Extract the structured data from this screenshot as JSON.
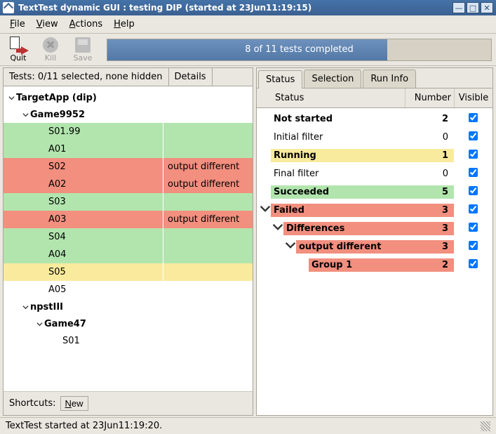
{
  "title": "TextTest dynamic GUI : testing DIP (started at 23Jun11:19:15)",
  "menus": {
    "file": "File",
    "view": "View",
    "actions": "Actions",
    "help": "Help"
  },
  "toolbar": {
    "quit": "Quit",
    "kill": "Kill",
    "save": "Save"
  },
  "progress": {
    "text": "8 of 11 tests completed",
    "percent": 73
  },
  "left": {
    "selection": "Tests: 0/11 selected, none hidden",
    "details": "Details",
    "root": "TargetApp (dip)",
    "suite1": "Game9952",
    "tests1": [
      {
        "name": "S01.99",
        "detail": "",
        "color": "green"
      },
      {
        "name": "A01",
        "detail": "",
        "color": "green"
      },
      {
        "name": "S02",
        "detail": "output different",
        "color": "red"
      },
      {
        "name": "A02",
        "detail": "output different",
        "color": "red"
      },
      {
        "name": "S03",
        "detail": "",
        "color": "green"
      },
      {
        "name": "A03",
        "detail": "output different",
        "color": "red"
      },
      {
        "name": "S04",
        "detail": "",
        "color": "green"
      },
      {
        "name": "A04",
        "detail": "",
        "color": "green"
      },
      {
        "name": "S05",
        "detail": "",
        "color": "yellow"
      },
      {
        "name": "A05",
        "detail": "",
        "color": ""
      }
    ],
    "suite2": "npstIII",
    "suite2sub": "Game47",
    "tests2": [
      {
        "name": "S01",
        "detail": "",
        "color": ""
      }
    ]
  },
  "shortcuts": {
    "label": "Shortcuts:",
    "new": "New"
  },
  "tabs": {
    "status": "Status",
    "selection": "Selection",
    "runinfo": "Run Info"
  },
  "status_head": {
    "status": "Status",
    "number": "Number",
    "visible": "Visible"
  },
  "status_rows": [
    {
      "indent": 0,
      "exp": false,
      "name": "Not started",
      "num": "2",
      "color": "",
      "bold": true
    },
    {
      "indent": 0,
      "exp": false,
      "name": "Initial filter",
      "num": "0",
      "color": "",
      "bold": false
    },
    {
      "indent": 0,
      "exp": false,
      "name": "Running",
      "num": "1",
      "color": "yellow",
      "bold": true
    },
    {
      "indent": 0,
      "exp": false,
      "name": "Final filter",
      "num": "0",
      "color": "",
      "bold": false
    },
    {
      "indent": 0,
      "exp": false,
      "name": "Succeeded",
      "num": "5",
      "color": "green",
      "bold": true
    },
    {
      "indent": 0,
      "exp": true,
      "name": "Failed",
      "num": "3",
      "color": "red",
      "bold": true
    },
    {
      "indent": 1,
      "exp": true,
      "name": "Differences",
      "num": "3",
      "color": "red",
      "bold": true
    },
    {
      "indent": 2,
      "exp": true,
      "name": "output different",
      "num": "3",
      "color": "red",
      "bold": true
    },
    {
      "indent": 3,
      "exp": false,
      "name": "Group 1",
      "num": "2",
      "color": "red",
      "bold": true
    }
  ],
  "statusline": "TextTest started at 23Jun11:19:20."
}
